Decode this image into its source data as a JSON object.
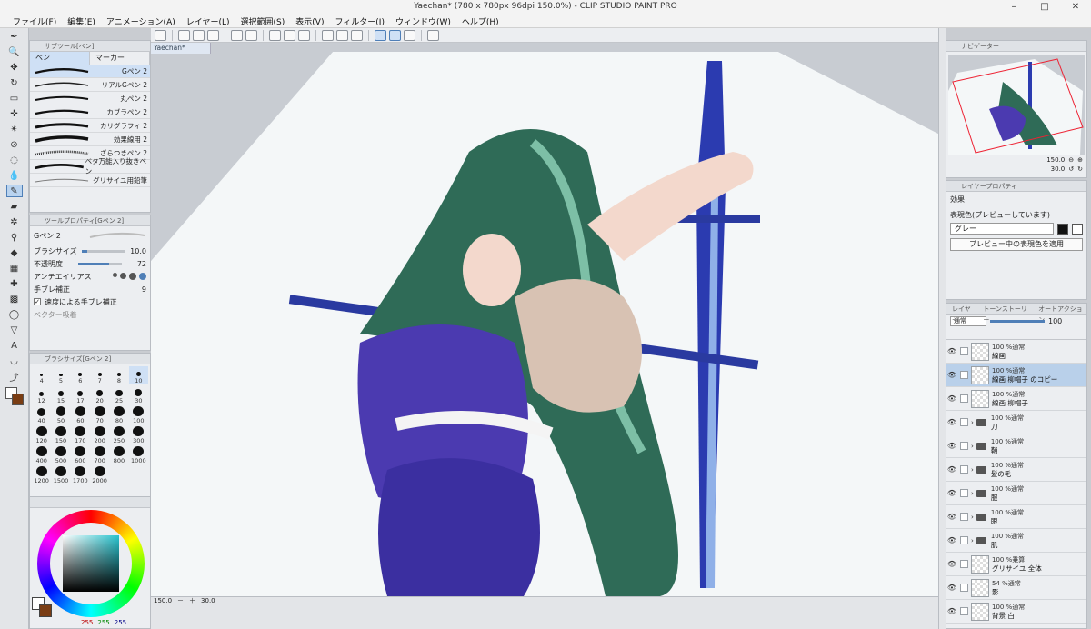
{
  "window": {
    "title": "Yaechan* (780 x 780px 96dpi 150.0%) - CLIP STUDIO PAINT PRO",
    "buttons": [
      "–",
      "□",
      "✕"
    ]
  },
  "menu": [
    "ファイル(F)",
    "編集(E)",
    "アニメーション(A)",
    "レイヤー(L)",
    "選択範囲(S)",
    "表示(V)",
    "フィルター(I)",
    "ウィンドウ(W)",
    "ヘルプ(H)"
  ],
  "subtool": {
    "header": "サブツール[ペン]",
    "tabs": [
      "ペン",
      "マーカー"
    ],
    "brushes": [
      "Gペン 2",
      "リアルGペン 2",
      "丸ペン 2",
      "カブラペン 2",
      "カリグラフィ 2",
      "効果線用 2",
      "ざらつきペン 2",
      "ベタ万能入り抜きペン",
      "グリサイユ用鉛筆"
    ]
  },
  "toolprop": {
    "header": "ツールプロパティ[Gペン 2]",
    "preset": "Gペン 2",
    "brush_size_label": "ブラシサイズ",
    "brush_size_value": "10.0",
    "opacity_label": "不透明度",
    "opacity_value": "72",
    "antialias_label": "アンチエイリアス",
    "stabilization_label": "手ブレ補正",
    "stabilization_value": "9",
    "speed_stab_label": "速度による手ブレ補正",
    "vector_label": "ベクター吸着",
    "brush_size_fill": 0.12,
    "opacity_fill": 0.72
  },
  "brushsize": {
    "header": "ブラシサイズ[Gペン 2]",
    "sizes": [
      "4",
      "5",
      "6",
      "7",
      "8",
      "10",
      "12",
      "15",
      "17",
      "20",
      "25",
      "30",
      "40",
      "50",
      "60",
      "70",
      "80",
      "100",
      "120",
      "150",
      "170",
      "200",
      "250",
      "300",
      "400",
      "500",
      "600",
      "700",
      "800",
      "1000",
      "1200",
      "1500",
      "1700",
      "2000"
    ]
  },
  "colors": {
    "r": "255",
    "g": "255",
    "b": "255",
    "accent": "#4f7fb7"
  },
  "doc": {
    "tab": "Yaechan*"
  },
  "status": {
    "zoom": "150.0",
    "angle": "30.0"
  },
  "navigator": {
    "header": "ナビゲーター",
    "zoom": "150.0",
    "angle": "30.0"
  },
  "layerprop": {
    "header": "レイヤープロパティ",
    "effect_label": "効果",
    "expr_label": "表現色(プレビューしています)",
    "expr_value": "グレー",
    "apply_button": "プレビュー中の表現色を適用"
  },
  "layers": {
    "tabs": [
      "レイヤー",
      "トーンストーリー",
      "オートアクション"
    ],
    "blend": "通常",
    "opacity": "100",
    "items": [
      {
        "pct": "100 %通常",
        "name": "線画",
        "type": "layer"
      },
      {
        "pct": "100 %通常",
        "name": "線画 柳帽子 のコピー",
        "type": "layer",
        "selected": true
      },
      {
        "pct": "100 %通常",
        "name": "線画 柳帽子",
        "type": "layer"
      },
      {
        "pct": "100 %通常",
        "name": "刀",
        "type": "folder"
      },
      {
        "pct": "100 %通常",
        "name": "鞘",
        "type": "folder"
      },
      {
        "pct": "100 %通常",
        "name": "髪の毛",
        "type": "folder"
      },
      {
        "pct": "100 %通常",
        "name": "服",
        "type": "folder"
      },
      {
        "pct": "100 %通常",
        "name": "眼",
        "type": "folder"
      },
      {
        "pct": "100 %通常",
        "name": "肌",
        "type": "folder"
      },
      {
        "pct": "100 %乗算",
        "name": "グリサイユ 全体",
        "type": "layer"
      },
      {
        "pct": "54 %通常",
        "name": "影",
        "type": "layer"
      },
      {
        "pct": "100 %通常",
        "name": "背景 白",
        "type": "layer"
      }
    ]
  }
}
